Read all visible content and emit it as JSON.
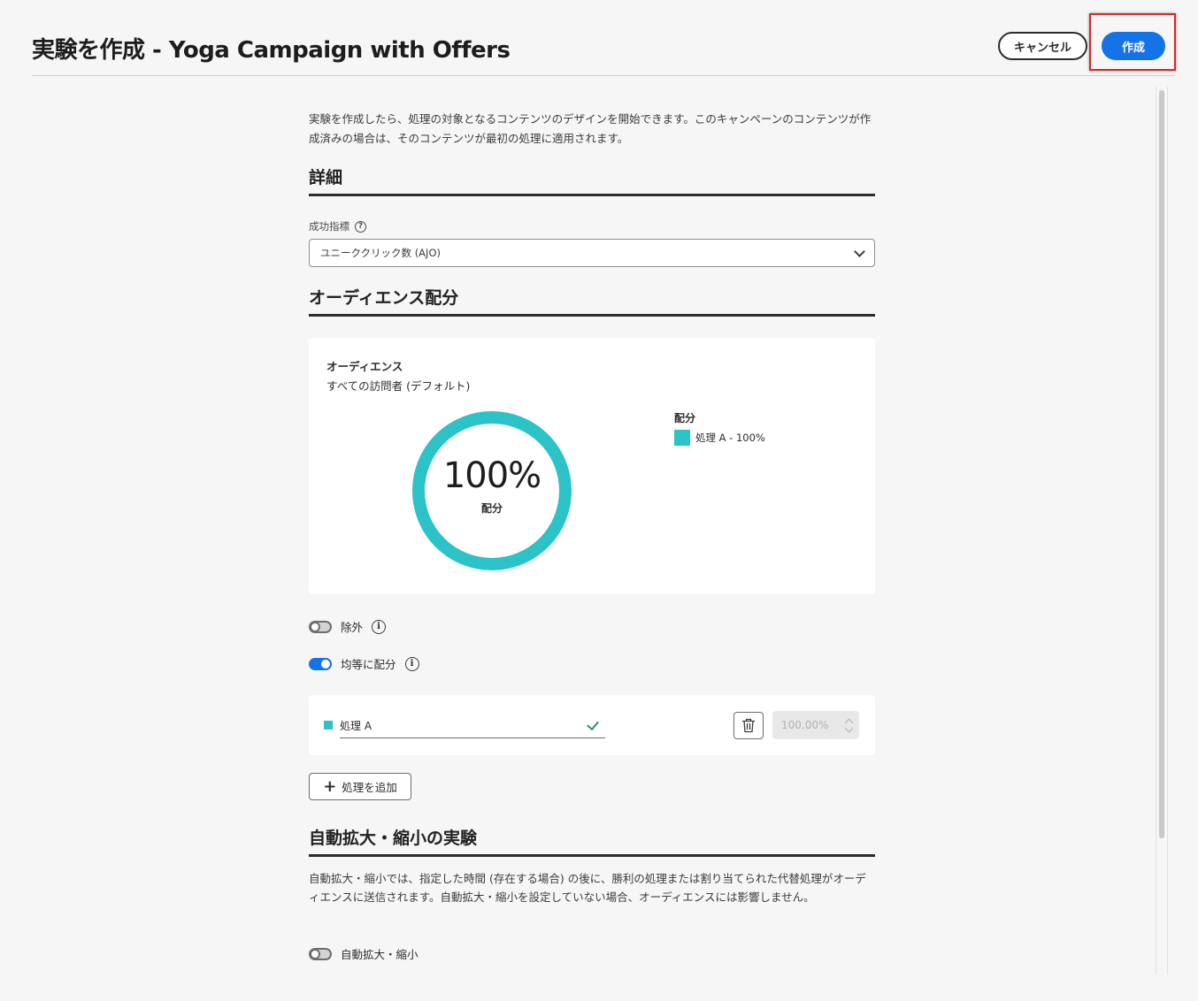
{
  "header": {
    "title": "実験を作成 - Yoga Campaign with Offers",
    "cancel_label": "キャンセル",
    "create_label": "作成"
  },
  "intro_text": "実験を作成したら、処理の対象となるコンテンツのデザインを開始できます。このキャンペーンのコンテンツが作成済みの場合は、そのコンテンツが最初の処理に適用されます。",
  "details": {
    "heading": "詳細",
    "metric_label": "成功指標",
    "metric_value": "ユニーククリック数 (AJO)"
  },
  "audience": {
    "heading": "オーディエンス配分",
    "audience_label": "オーディエンス",
    "audience_value": "すべての訪問者 (デフォルト)",
    "donut_percent": "100%",
    "donut_sub": "配分",
    "legend_title": "配分",
    "legend_item": "処理 A - 100%",
    "allocation_fraction": 1.0,
    "color": "#2bc3c8"
  },
  "toggles": {
    "exclude_label": "除外",
    "exclude_on": false,
    "even_label": "均等に配分",
    "even_on": true
  },
  "treatment": {
    "name": "処理 A",
    "percent": "100.00%"
  },
  "add_treatment_label": "処理を追加",
  "auto": {
    "heading": "自動拡大・縮小の実験",
    "description": "自動拡大・縮小では、指定した時間 (存在する場合) の後に、勝利の処理または割り当てられた代替処理がオーディエンスに送信されます。自動拡大・縮小を設定していない場合、オーディエンスには影響しません。",
    "toggle_label": "自動拡大・縮小",
    "toggle_on": false
  },
  "colors": {
    "accent": "#1473e6",
    "highlight": "#d62828",
    "treatment": "#2bc3c8"
  }
}
